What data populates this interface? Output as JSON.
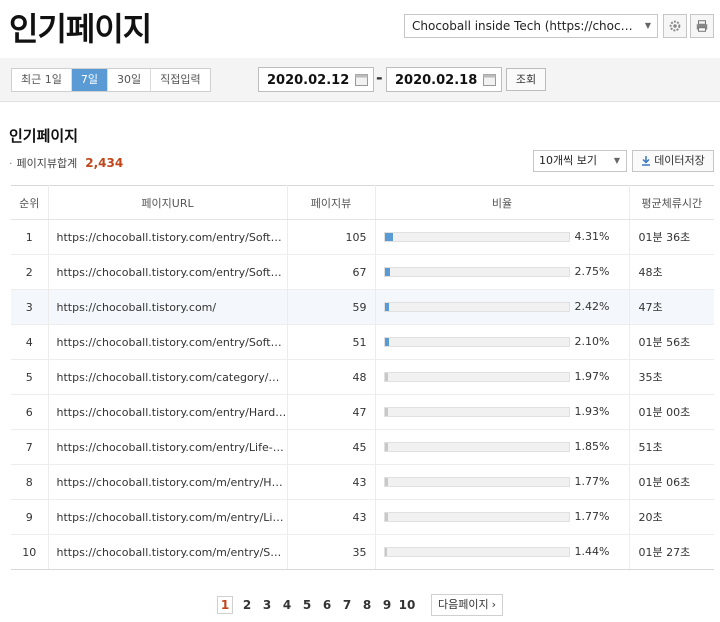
{
  "header": {
    "title": "인기페이지",
    "blog_select": "Chocoball inside Tech (https://chocoball.t…",
    "settings_icon": "gear-icon",
    "print_icon": "printer-icon"
  },
  "filter": {
    "periods": [
      {
        "label": "최근 1일",
        "active": false
      },
      {
        "label": "7일",
        "active": true
      },
      {
        "label": "30일",
        "active": false
      },
      {
        "label": "직접입력",
        "active": false
      }
    ],
    "start_date": "2020.02.12",
    "end_date": "2020.02.18",
    "separator": "-",
    "search_label": "조회"
  },
  "section": {
    "title": "인기페이지",
    "total_label": "페이지뷰합계",
    "total_value": "2,434",
    "per_page": "10개씩 보기",
    "save_label": "데이터저장"
  },
  "table": {
    "columns": [
      "순위",
      "페이지URL",
      "페이지뷰",
      "비율",
      "평균체류시간"
    ],
    "highlight_color": "#f4f8fc",
    "bar_color_blue": "#5b9bd5",
    "bar_color_gray": "#c8c8c8",
    "rows": [
      {
        "rank": "1",
        "url": "https://chocoball.tistory.com/entry/Softw…",
        "views": "105",
        "ratio": "4.31%",
        "pct": 4.31,
        "time": "01분 36초",
        "bar": "blue"
      },
      {
        "rank": "2",
        "url": "https://chocoball.tistory.com/entry/Softw…",
        "views": "67",
        "ratio": "2.75%",
        "pct": 2.75,
        "time": "48초",
        "bar": "blue"
      },
      {
        "rank": "3",
        "url": "https://chocoball.tistory.com/",
        "views": "59",
        "ratio": "2.42%",
        "pct": 2.42,
        "time": "47초",
        "bar": "blue",
        "highlight": true
      },
      {
        "rank": "4",
        "url": "https://chocoball.tistory.com/entry/Softw…",
        "views": "51",
        "ratio": "2.10%",
        "pct": 2.1,
        "time": "01분 56초",
        "bar": "blue"
      },
      {
        "rank": "5",
        "url": "https://chocoball.tistory.com/category/H…",
        "views": "48",
        "ratio": "1.97%",
        "pct": 1.97,
        "time": "35초",
        "bar": "gray"
      },
      {
        "rank": "6",
        "url": "https://chocoball.tistory.com/entry/Hard…",
        "views": "47",
        "ratio": "1.93%",
        "pct": 1.93,
        "time": "01분 00초",
        "bar": "gray"
      },
      {
        "rank": "7",
        "url": "https://chocoball.tistory.com/entry/Life-a…",
        "views": "45",
        "ratio": "1.85%",
        "pct": 1.85,
        "time": "51초",
        "bar": "gray"
      },
      {
        "rank": "8",
        "url": "https://chocoball.tistory.com/m/entry/Ha…",
        "views": "43",
        "ratio": "1.77%",
        "pct": 1.77,
        "time": "01분 06초",
        "bar": "gray"
      },
      {
        "rank": "9",
        "url": "https://chocoball.tistory.com/m/entry/Lif…",
        "views": "43",
        "ratio": "1.77%",
        "pct": 1.77,
        "time": "20초",
        "bar": "gray"
      },
      {
        "rank": "10",
        "url": "https://chocoball.tistory.com/m/entry/Sof…",
        "views": "35",
        "ratio": "1.44%",
        "pct": 1.44,
        "time": "01분 27초",
        "bar": "gray"
      }
    ]
  },
  "pagination": {
    "pages": [
      "1",
      "2",
      "3",
      "4",
      "5",
      "6",
      "7",
      "8",
      "9",
      "10"
    ],
    "current": "1",
    "next_label": "다음페이지"
  }
}
